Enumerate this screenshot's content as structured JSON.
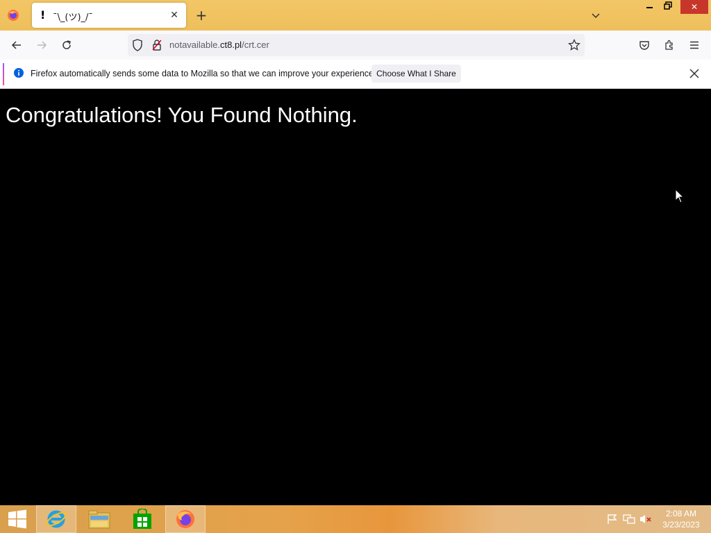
{
  "browser": {
    "tab": {
      "title": "¯\\_(ツ)_/¯",
      "favicon_glyph": "!"
    },
    "url": {
      "prefix": "notavailable.",
      "domain": "ct8.pl",
      "path": "/crt.cer"
    }
  },
  "notification": {
    "message": "Firefox automatically sends some data to Mozilla so that we can improve your experience.",
    "button_label": "Choose What I Share"
  },
  "page": {
    "heading": "Congratulations! You Found Nothing.",
    "background_color": "#000000",
    "text_color": "#ffffff"
  },
  "taskbar": {
    "apps": [
      "start-button",
      "internet-explorer",
      "file-explorer",
      "windows-store",
      "firefox"
    ],
    "clock_time": "2:08 AM",
    "clock_date": "3/23/2023"
  },
  "colors": {
    "tabbar": "#f0c060",
    "close_button": "#c7362b",
    "accent": "#0060df"
  }
}
